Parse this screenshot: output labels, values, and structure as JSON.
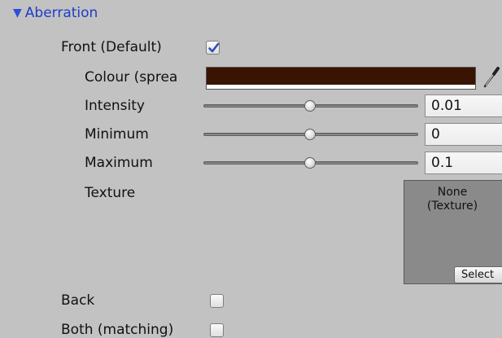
{
  "section": {
    "title": "Aberration",
    "expanded": true
  },
  "front": {
    "label": "Front (Default)",
    "checked": true,
    "colour": {
      "label": "Colour (sprea",
      "value": "#3a1403"
    },
    "intensity": {
      "label": "Intensity",
      "value": "0.01",
      "slider_fraction": 0.52
    },
    "minimum": {
      "label": "Minimum",
      "value": "0",
      "slider_fraction": 0.52
    },
    "maximum": {
      "label": "Maximum",
      "value": "0.1",
      "slider_fraction": 0.52
    },
    "texture": {
      "label": "Texture",
      "value_line1": "None",
      "value_line2": "(Texture)",
      "select_label": "Select"
    }
  },
  "back": {
    "label": "Back",
    "checked": false
  },
  "both": {
    "label": "Both (matching)",
    "checked": false
  },
  "colors": {
    "background": "#c2c2c2",
    "header_blue": "#1f3cc8",
    "checkmark": "#2b4fb8"
  }
}
